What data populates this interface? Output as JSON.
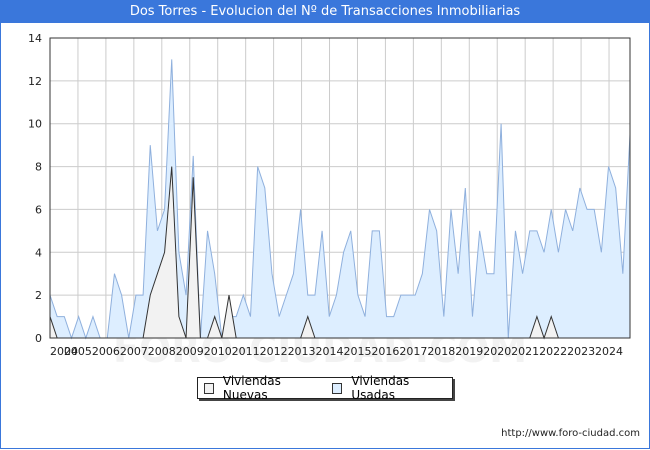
{
  "title": "Dos Torres - Evolucion del Nº de Transacciones Inmobiliarias",
  "watermark": "FORO-CIUDAD.COM",
  "source_url": "http://www.foro-ciudad.com",
  "legend": {
    "nuevas_label": "Viviendas Nuevas",
    "usadas_label": "Viviendas Usadas"
  },
  "colors": {
    "title_bg": "#3a77db",
    "usadas_fill": "#ddeeff",
    "usadas_line": "#8fb0dd",
    "nuevas_fill": "#f2f2f2",
    "nuevas_line": "#333333",
    "grid": "#cccccc"
  },
  "chart_data": {
    "type": "area",
    "x_start_year": 2004,
    "x_step": "quarter",
    "x_tick_labels": [
      "2004",
      "2005",
      "2006",
      "2007",
      "2008",
      "2009",
      "2010",
      "2011",
      "2012",
      "2013",
      "2014",
      "2015",
      "2016",
      "2017",
      "2018",
      "2019",
      "2020",
      "2021",
      "2022",
      "2023",
      "2024"
    ],
    "y_ticks": [
      0,
      2,
      4,
      6,
      8,
      10,
      12,
      14
    ],
    "ylim": [
      0,
      14
    ],
    "grid": true,
    "legend_position": "bottom-center",
    "series": [
      {
        "name": "Viviendas Usadas",
        "values": [
          2,
          1,
          1,
          0,
          1,
          0,
          1,
          0,
          0,
          3,
          2,
          0,
          2,
          2,
          9,
          5,
          6,
          13,
          4,
          2,
          8.5,
          0,
          5,
          3,
          0,
          1,
          1,
          2,
          1,
          8,
          7,
          3,
          1,
          2,
          3,
          6,
          2,
          2,
          5,
          1,
          2,
          4,
          5,
          2,
          1,
          5,
          5,
          1,
          1,
          2,
          2,
          2,
          3,
          6,
          5,
          1,
          6,
          3,
          7,
          1,
          5,
          3,
          3,
          10,
          0,
          5,
          3,
          5,
          5,
          4,
          6,
          4,
          6,
          5,
          7,
          6,
          6,
          4,
          8,
          7,
          3,
          9.5
        ]
      },
      {
        "name": "Viviendas Nuevas",
        "values": [
          1,
          0,
          0,
          0,
          0,
          0,
          0,
          0,
          0,
          0,
          0,
          0,
          0,
          0,
          2,
          3,
          4,
          8,
          1,
          0,
          7.5,
          0,
          0,
          1,
          0,
          2,
          0,
          0,
          0,
          0,
          0,
          0,
          0,
          0,
          0,
          0,
          1,
          0,
          0,
          0,
          0,
          0,
          0,
          0,
          0,
          0,
          0,
          0,
          0,
          0,
          0,
          0,
          0,
          0,
          0,
          0,
          0,
          0,
          0,
          0,
          0,
          0,
          0,
          0,
          0,
          0,
          0,
          0,
          1,
          0,
          1,
          0,
          0,
          0,
          0,
          0,
          0,
          0,
          0,
          0,
          0,
          0
        ]
      }
    ]
  }
}
